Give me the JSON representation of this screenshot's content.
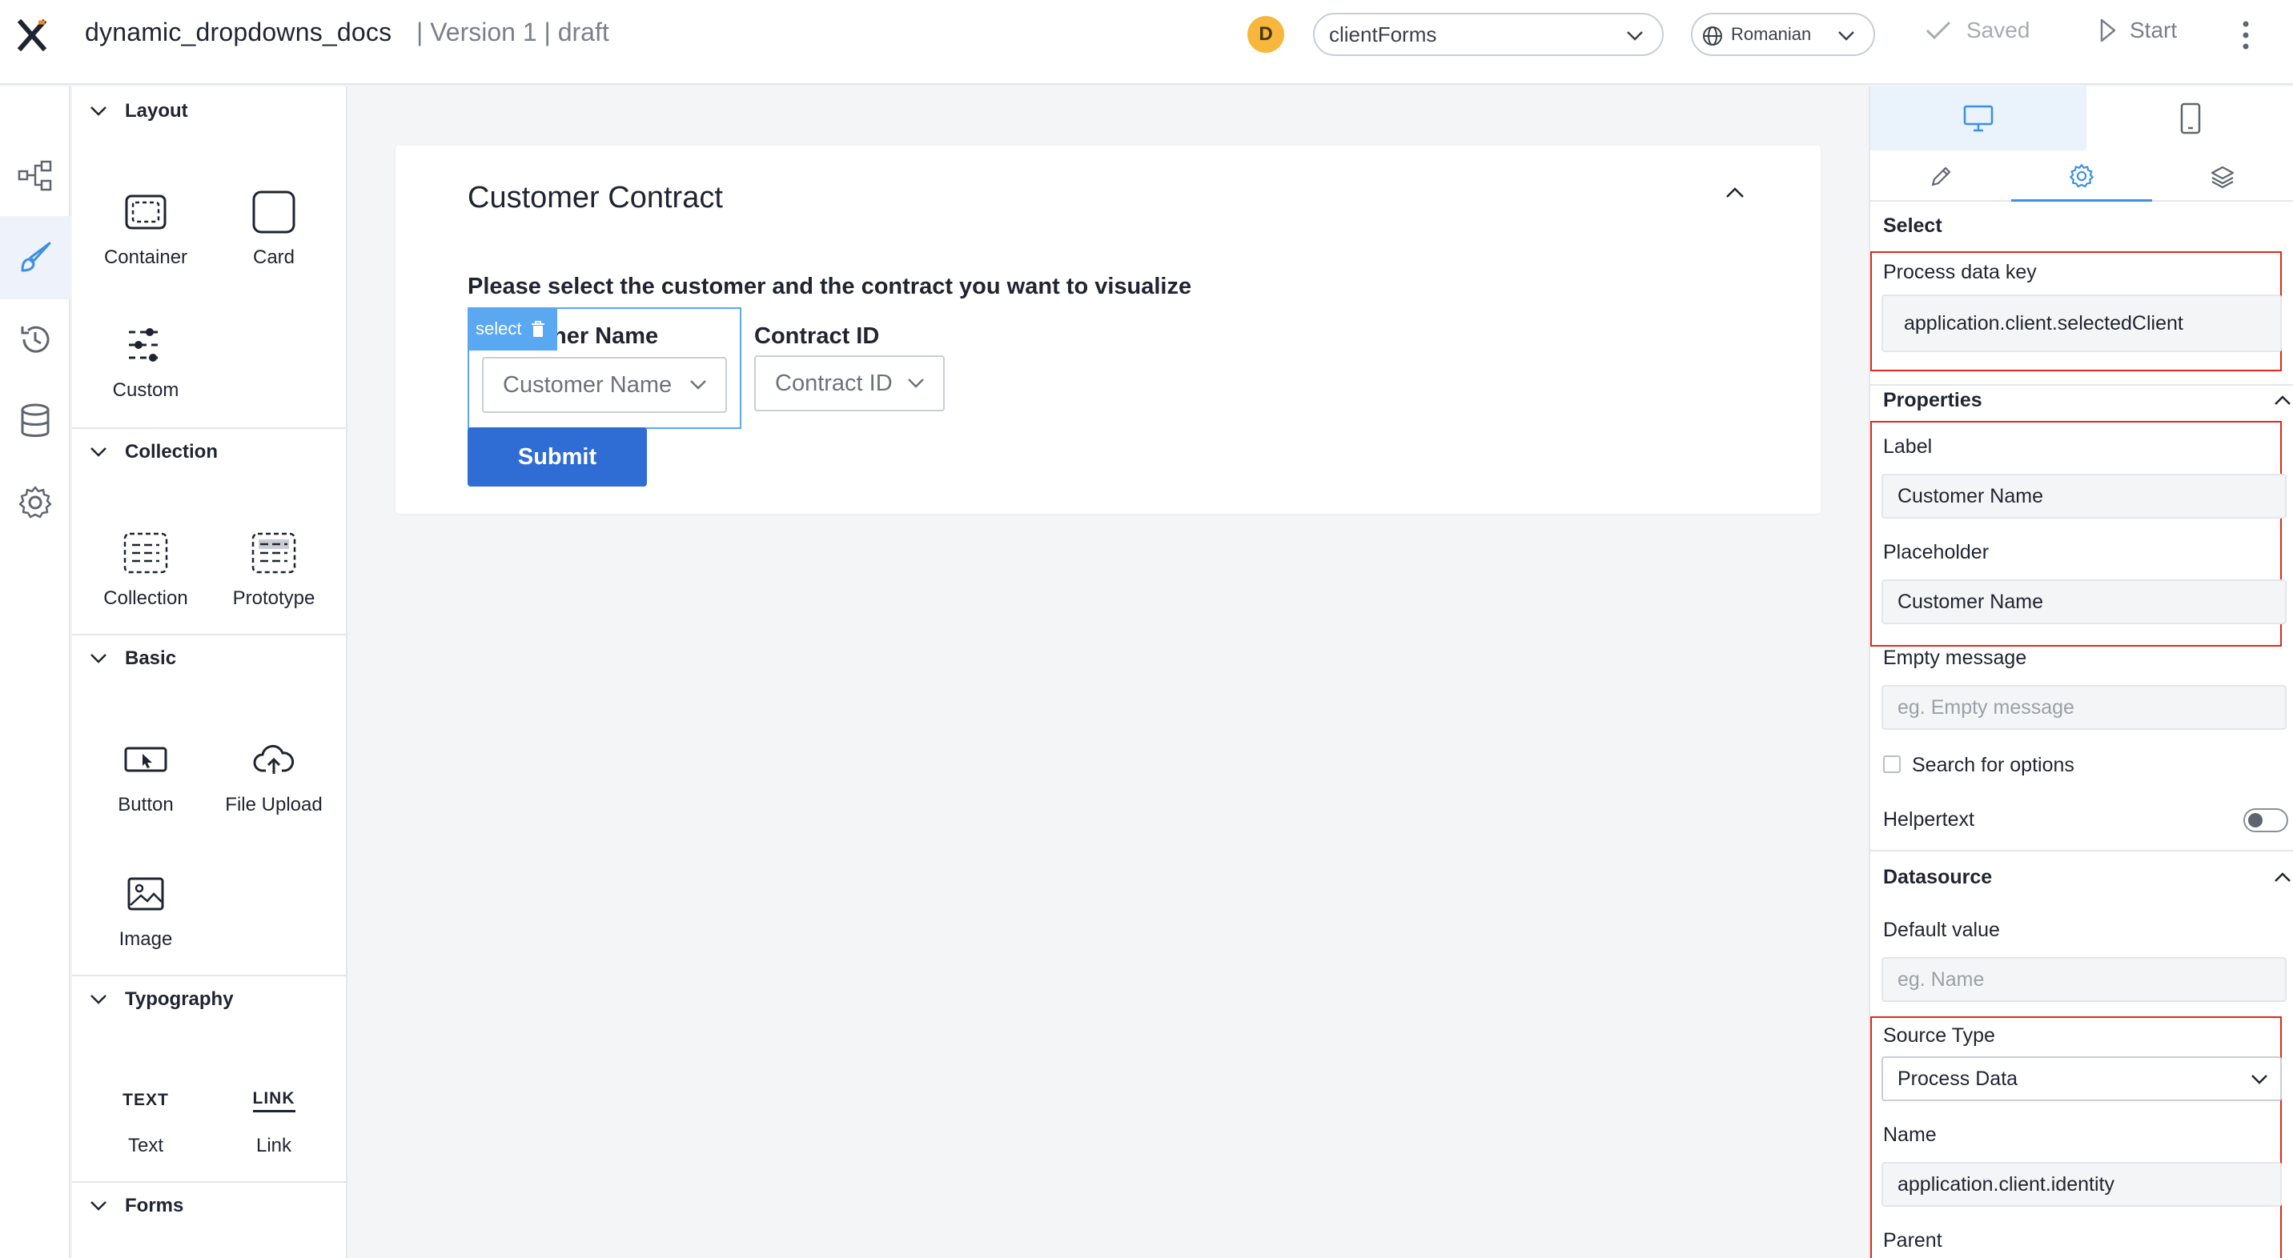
{
  "header": {
    "app_title": "dynamic_dropdowns_docs",
    "version": "| Version 1 | draft",
    "avatar_initial": "D",
    "form_select": "clientForms",
    "language_select": "Romanian",
    "saved_label": "Saved",
    "start_label": "Start"
  },
  "palette": {
    "sections": {
      "layout": "Layout",
      "collection": "Collection",
      "basic": "Basic",
      "typography": "Typography",
      "forms": "Forms"
    },
    "items": {
      "container": "Container",
      "card": "Card",
      "custom": "Custom",
      "collection": "Collection",
      "prototype": "Prototype",
      "button": "Button",
      "file_upload": "File Upload",
      "image": "Image",
      "text": "Text",
      "text_glyph": "TEXT",
      "link": "Link",
      "link_glyph": "LINK"
    }
  },
  "canvas": {
    "card_title": "Customer Contract",
    "description": "Please select the customer and the contract you want to visualize",
    "select_tag": "select",
    "customer_label_visible": "ner Name",
    "customer_placeholder": "Customer Name",
    "contract_label": "Contract ID",
    "contract_placeholder": "Contract ID",
    "submit_label": "Submit"
  },
  "panel": {
    "select_title": "Select",
    "process_data_key_label": "Process data key",
    "process_data_key_value": "application.client.selectedClient",
    "properties_title": "Properties",
    "label_label": "Label",
    "label_value": "Customer Name",
    "placeholder_label": "Placeholder",
    "placeholder_value": "Customer Name",
    "empty_message_label": "Empty message",
    "empty_message_placeholder": "eg. Empty message",
    "search_options_label": "Search for options",
    "helpertext_label": "Helpertext",
    "datasource_title": "Datasource",
    "default_value_label": "Default value",
    "default_value_placeholder": "eg. Name",
    "source_type_label": "Source Type",
    "source_type_value": "Process Data",
    "name_label": "Name",
    "name_value": "application.client.identity",
    "parent_label": "Parent"
  },
  "colors": {
    "accent": "#2f6dd5",
    "selection": "#5aa7f2",
    "highlight_box": "#e0281e",
    "avatar": "#f6b73c"
  }
}
